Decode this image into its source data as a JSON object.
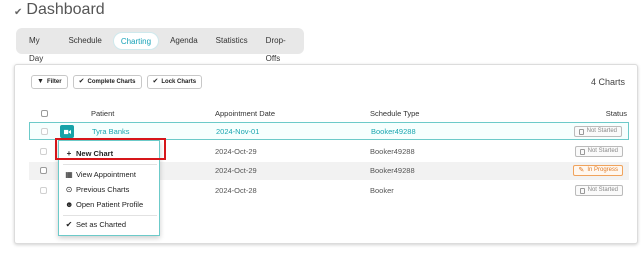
{
  "page": {
    "title": "Dashboard"
  },
  "tabs": [
    {
      "label": "My Day",
      "active": false
    },
    {
      "label": "Schedule",
      "active": false
    },
    {
      "label": "Charting",
      "active": true
    },
    {
      "label": "Agenda",
      "active": false
    },
    {
      "label": "Statistics",
      "active": false
    },
    {
      "label": "Drop-Offs",
      "active": false
    }
  ],
  "toolbar": {
    "filter_label": "Filter",
    "complete_label": "Complete Charts",
    "lock_label": "Lock Charts"
  },
  "count_label": "4 Charts",
  "table": {
    "headers": {
      "patient": "Patient",
      "date": "Appointment Date",
      "schedule": "Schedule Type",
      "status": "Status"
    },
    "rows": [
      {
        "patient": "Tyra Banks",
        "date": "2024-Nov-01",
        "schedule": "Booker49288",
        "status": "Not Started"
      },
      {
        "patient": "",
        "date": "2024-Oct-29",
        "schedule": "Booker49288",
        "status": "Not Started"
      },
      {
        "patient": "",
        "date": "2024-Oct-29",
        "schedule": "Booker49288",
        "status": "In Progress"
      },
      {
        "patient": "",
        "date": "2024-Oct-28",
        "schedule": "Booker",
        "status": "Not Started"
      }
    ]
  },
  "context_menu": {
    "new_chart": "New Chart",
    "view_appointment": "View Appointment",
    "previous_charts": "Previous Charts",
    "open_profile": "Open Patient Profile",
    "set_charted": "Set as Charted"
  },
  "colors": {
    "accent": "#17a2a8",
    "highlight_border": "#d6161a",
    "in_progress": "#e07a26"
  }
}
